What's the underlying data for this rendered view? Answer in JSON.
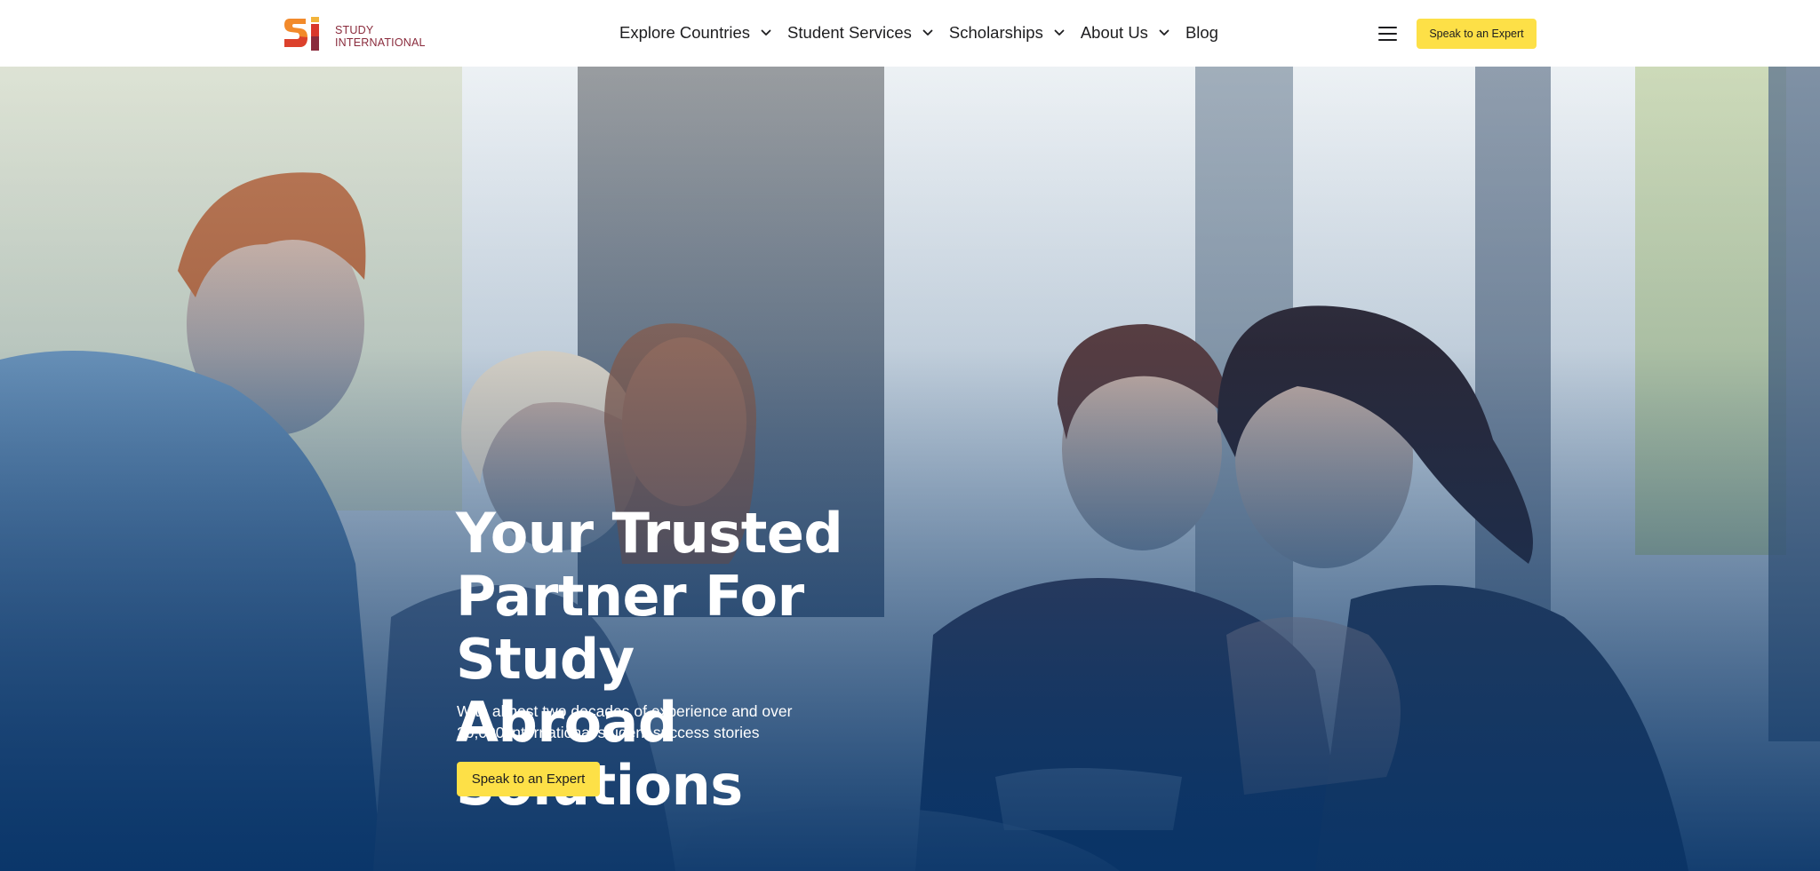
{
  "brand": {
    "logo_letters": "SI",
    "name_line1": "STUDY",
    "name_line2": "INTERNATIONAL",
    "colors": {
      "orange": "#f28a2b",
      "red": "#d9382c",
      "maroon": "#8a2b3c"
    }
  },
  "nav": {
    "items": [
      {
        "label": "Explore Countries",
        "has_dropdown": true
      },
      {
        "label": "Student Services",
        "has_dropdown": true
      },
      {
        "label": "Scholarships",
        "has_dropdown": true
      },
      {
        "label": "About Us",
        "has_dropdown": true
      },
      {
        "label": "Blog",
        "has_dropdown": false
      }
    ],
    "menu_icon": "hamburger-icon",
    "cta_label": "Speak to an Expert"
  },
  "hero": {
    "title_lines": [
      "Your Trusted",
      "Partner For Study",
      "Abroad Solutions"
    ],
    "subtitle_lines": [
      "With almost two decades of experience and over",
      "20,000 international student success stories"
    ],
    "cta_label": "Speak to an Expert",
    "background": "photo-students-laughing-at-table"
  },
  "colors": {
    "accent_yellow": "#fde047",
    "hero_blue": "#0b3a6f",
    "text_dark": "#1d1d1f"
  }
}
